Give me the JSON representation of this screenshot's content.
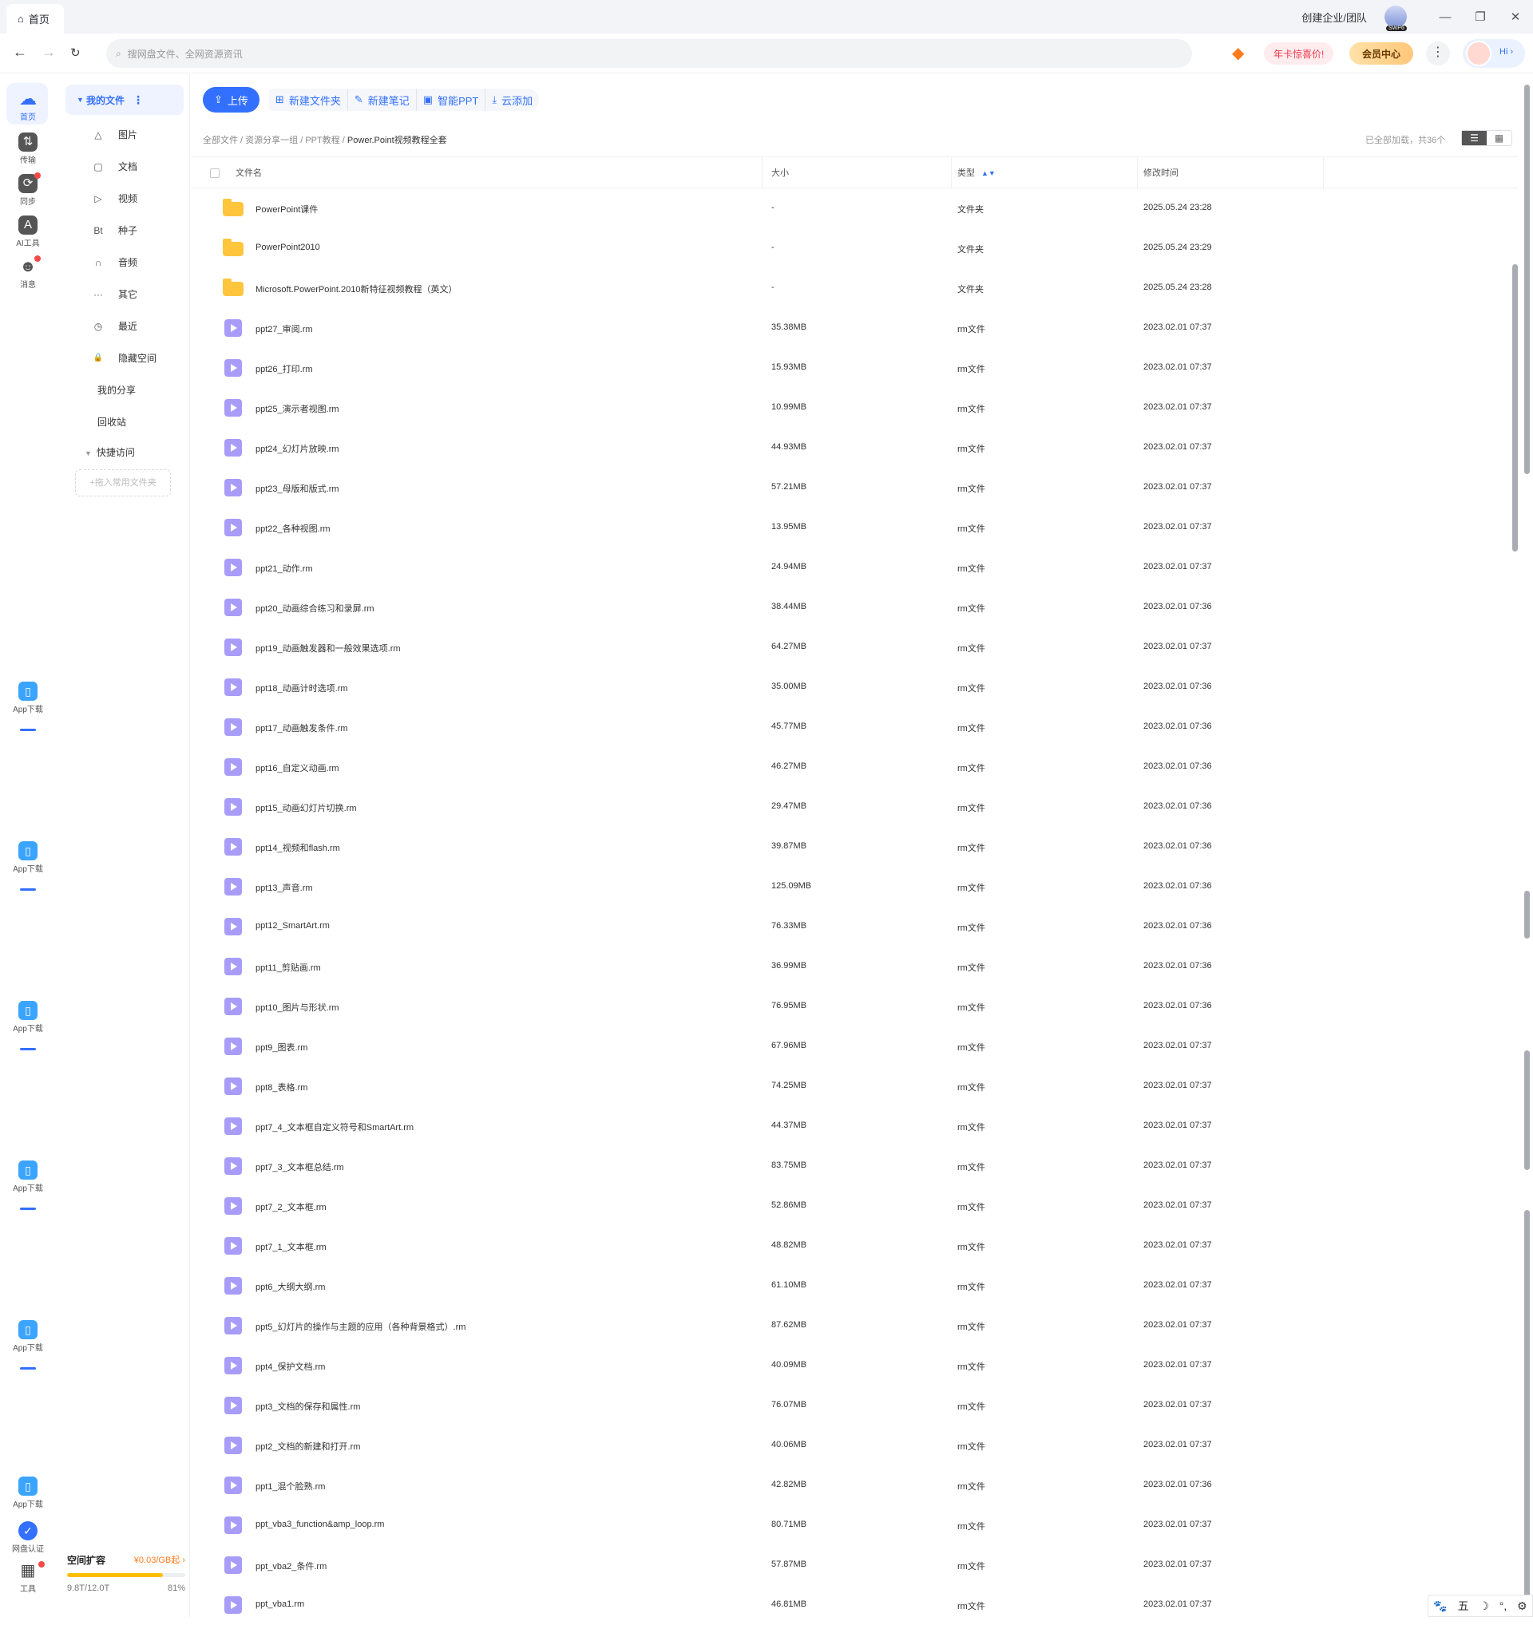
{
  "window": {
    "tab_icon": "home-icon",
    "tab_label": "首页",
    "team_link": "创建企业/团队",
    "avatar_tag": "SWP6",
    "controls": [
      "—",
      "❐",
      "✕"
    ]
  },
  "nav": {
    "search_placeholder": "搜网盘文件、全网资源资讯",
    "promo_label": "年卡惊喜价!",
    "vip_label": "会员中心",
    "more_glyph": "⋮",
    "hi_label": "Hi ›"
  },
  "rail": {
    "items": [
      {
        "label": "首页",
        "icon": "cloud-icon",
        "glyph": "☁"
      },
      {
        "label": "传输",
        "icon": "transfer-icon",
        "glyph": "⇅"
      },
      {
        "label": "同步",
        "icon": "sync-icon",
        "glyph": "⟳"
      },
      {
        "label": "AI工具",
        "icon": "ai-icon",
        "glyph": "A"
      },
      {
        "label": "消息",
        "icon": "message-icon",
        "glyph": "☻"
      }
    ],
    "app_download_label": "App下载",
    "verify_label": "网盘认证",
    "tools_label": "工具"
  },
  "sidebar": {
    "my_files": "我的文件",
    "items": [
      {
        "label": "图片",
        "icon": "image-icon",
        "glyph": "△"
      },
      {
        "label": "文档",
        "icon": "document-icon",
        "glyph": "▢"
      },
      {
        "label": "视频",
        "icon": "video-icon",
        "glyph": "▷"
      },
      {
        "label": "种子",
        "icon": "torrent-icon",
        "glyph": "Bt"
      },
      {
        "label": "音频",
        "icon": "headphones-icon",
        "glyph": "∩"
      },
      {
        "label": "其它",
        "icon": "more-icon",
        "glyph": "···"
      },
      {
        "label": "最近",
        "icon": "clock-icon",
        "glyph": "◷"
      },
      {
        "label": "隐藏空间",
        "icon": "lock-icon",
        "glyph": "🔒"
      }
    ],
    "my_share": "我的分享",
    "recycle": "回收站",
    "quick_access": "快捷访问",
    "drop_hint": "+拖入常用文件夹",
    "space": {
      "title": "空间扩容",
      "price": "¥0.03/GB起 ›",
      "used": "9.8T/12.0T",
      "percent": "81%",
      "fraction": 0.81
    }
  },
  "toolbar": {
    "upload": "上传",
    "new_folder": "新建文件夹",
    "new_note": "新建笔记",
    "smart_ppt": "智能PPT",
    "cloud_add": "云添加"
  },
  "breadcrumb": {
    "path": [
      "全部文件",
      "资源分享一组",
      "PPT教程"
    ],
    "current": "Power.Point视频教程全套",
    "separator": " / "
  },
  "list_status": "已全部加载，共36个",
  "columns": {
    "name": "文件名",
    "size": "大小",
    "type": "类型",
    "modified": "修改时间"
  },
  "files": [
    {
      "name": "PowerPoint课件",
      "size": "-",
      "type": "文件夹",
      "modified": "2025.05.24 23:28",
      "kind": "folder"
    },
    {
      "name": "PowerPoint2010",
      "size": "-",
      "type": "文件夹",
      "modified": "2025.05.24 23:29",
      "kind": "folder"
    },
    {
      "name": "Microsoft.PowerPoint.2010新特征视频教程（英文）",
      "size": "-",
      "type": "文件夹",
      "modified": "2025.05.24 23:28",
      "kind": "folder"
    },
    {
      "name": "ppt27_审阅.rm",
      "size": "35.38MB",
      "type": "rm文件",
      "modified": "2023.02.01 07:37",
      "kind": "media"
    },
    {
      "name": "ppt26_打印.rm",
      "size": "15.93MB",
      "type": "rm文件",
      "modified": "2023.02.01 07:37",
      "kind": "media"
    },
    {
      "name": "ppt25_演示者视图.rm",
      "size": "10.99MB",
      "type": "rm文件",
      "modified": "2023.02.01 07:37",
      "kind": "media"
    },
    {
      "name": "ppt24_幻灯片放映.rm",
      "size": "44.93MB",
      "type": "rm文件",
      "modified": "2023.02.01 07:37",
      "kind": "media"
    },
    {
      "name": "ppt23_母版和版式.rm",
      "size": "57.21MB",
      "type": "rm文件",
      "modified": "2023.02.01 07:37",
      "kind": "media"
    },
    {
      "name": "ppt22_各种视图.rm",
      "size": "13.95MB",
      "type": "rm文件",
      "modified": "2023.02.01 07:37",
      "kind": "media"
    },
    {
      "name": "ppt21_动作.rm",
      "size": "24.94MB",
      "type": "rm文件",
      "modified": "2023.02.01 07:37",
      "kind": "media"
    },
    {
      "name": "ppt20_动画综合练习和录屏.rm",
      "size": "38.44MB",
      "type": "rm文件",
      "modified": "2023.02.01 07:36",
      "kind": "media"
    },
    {
      "name": "ppt19_动画触发器和一般效果选项.rm",
      "size": "64.27MB",
      "type": "rm文件",
      "modified": "2023.02.01 07:37",
      "kind": "media"
    },
    {
      "name": "ppt18_动画计时选项.rm",
      "size": "35.00MB",
      "type": "rm文件",
      "modified": "2023.02.01 07:36",
      "kind": "media"
    },
    {
      "name": "ppt17_动画触发条件.rm",
      "size": "45.77MB",
      "type": "rm文件",
      "modified": "2023.02.01 07:36",
      "kind": "media"
    },
    {
      "name": "ppt16_自定义动画.rm",
      "size": "46.27MB",
      "type": "rm文件",
      "modified": "2023.02.01 07:36",
      "kind": "media"
    },
    {
      "name": "ppt15_动画幻灯片切换.rm",
      "size": "29.47MB",
      "type": "rm文件",
      "modified": "2023.02.01 07:36",
      "kind": "media"
    },
    {
      "name": "ppt14_视频和flash.rm",
      "size": "39.87MB",
      "type": "rm文件",
      "modified": "2023.02.01 07:36",
      "kind": "media"
    },
    {
      "name": "ppt13_声音.rm",
      "size": "125.09MB",
      "type": "rm文件",
      "modified": "2023.02.01 07:36",
      "kind": "media"
    },
    {
      "name": "ppt12_SmartArt.rm",
      "size": "76.33MB",
      "type": "rm文件",
      "modified": "2023.02.01 07:36",
      "kind": "media"
    },
    {
      "name": "ppt11_剪贴画.rm",
      "size": "36.99MB",
      "type": "rm文件",
      "modified": "2023.02.01 07:36",
      "kind": "media"
    },
    {
      "name": "ppt10_图片与形状.rm",
      "size": "76.95MB",
      "type": "rm文件",
      "modified": "2023.02.01 07:36",
      "kind": "media"
    },
    {
      "name": "ppt9_图表.rm",
      "size": "67.96MB",
      "type": "rm文件",
      "modified": "2023.02.01 07:37",
      "kind": "media"
    },
    {
      "name": "ppt8_表格.rm",
      "size": "74.25MB",
      "type": "rm文件",
      "modified": "2023.02.01 07:37",
      "kind": "media"
    },
    {
      "name": "ppt7_4_文本框自定义符号和SmartArt.rm",
      "size": "44.37MB",
      "type": "rm文件",
      "modified": "2023.02.01 07:37",
      "kind": "media"
    },
    {
      "name": "ppt7_3_文本框总结.rm",
      "size": "83.75MB",
      "type": "rm文件",
      "modified": "2023.02.01 07:37",
      "kind": "media"
    },
    {
      "name": "ppt7_2_文本框.rm",
      "size": "52.86MB",
      "type": "rm文件",
      "modified": "2023.02.01 07:37",
      "kind": "media"
    },
    {
      "name": "ppt7_1_文本框.rm",
      "size": "48.82MB",
      "type": "rm文件",
      "modified": "2023.02.01 07:37",
      "kind": "media"
    },
    {
      "name": "ppt6_大纲大纲.rm",
      "size": "61.10MB",
      "type": "rm文件",
      "modified": "2023.02.01 07:37",
      "kind": "media"
    },
    {
      "name": "ppt5_幻灯片的操作与主题的应用（各种背景格式）.rm",
      "size": "87.62MB",
      "type": "rm文件",
      "modified": "2023.02.01 07:37",
      "kind": "media"
    },
    {
      "name": "ppt4_保护文档.rm",
      "size": "40.09MB",
      "type": "rm文件",
      "modified": "2023.02.01 07:37",
      "kind": "media"
    },
    {
      "name": "ppt3_文档的保存和属性.rm",
      "size": "76.07MB",
      "type": "rm文件",
      "modified": "2023.02.01 07:37",
      "kind": "media"
    },
    {
      "name": "ppt2_文档的新建和打开.rm",
      "size": "40.06MB",
      "type": "rm文件",
      "modified": "2023.02.01 07:37",
      "kind": "media"
    },
    {
      "name": "ppt1_混个脸熟.rm",
      "size": "42.82MB",
      "type": "rm文件",
      "modified": "2023.02.01 07:36",
      "kind": "media"
    },
    {
      "name": "ppt_vba3_function&amp_loop.rm",
      "size": "80.71MB",
      "type": "rm文件",
      "modified": "2023.02.01 07:37",
      "kind": "media"
    },
    {
      "name": "ppt_vba2_条件.rm",
      "size": "57.87MB",
      "type": "rm文件",
      "modified": "2023.02.01 07:37",
      "kind": "media"
    },
    {
      "name": "ppt_vba1.rm",
      "size": "46.81MB",
      "type": "rm文件",
      "modified": "2023.02.01 07:37",
      "kind": "media"
    }
  ],
  "ime": [
    "🐾",
    "五",
    "☽",
    "°,",
    "⚙"
  ],
  "colors": {
    "accent": "#3370ff",
    "folder": "#ffc53d",
    "media": "#a79cf7",
    "promo": "#ef3a4c",
    "storage": "#ffbf00"
  }
}
